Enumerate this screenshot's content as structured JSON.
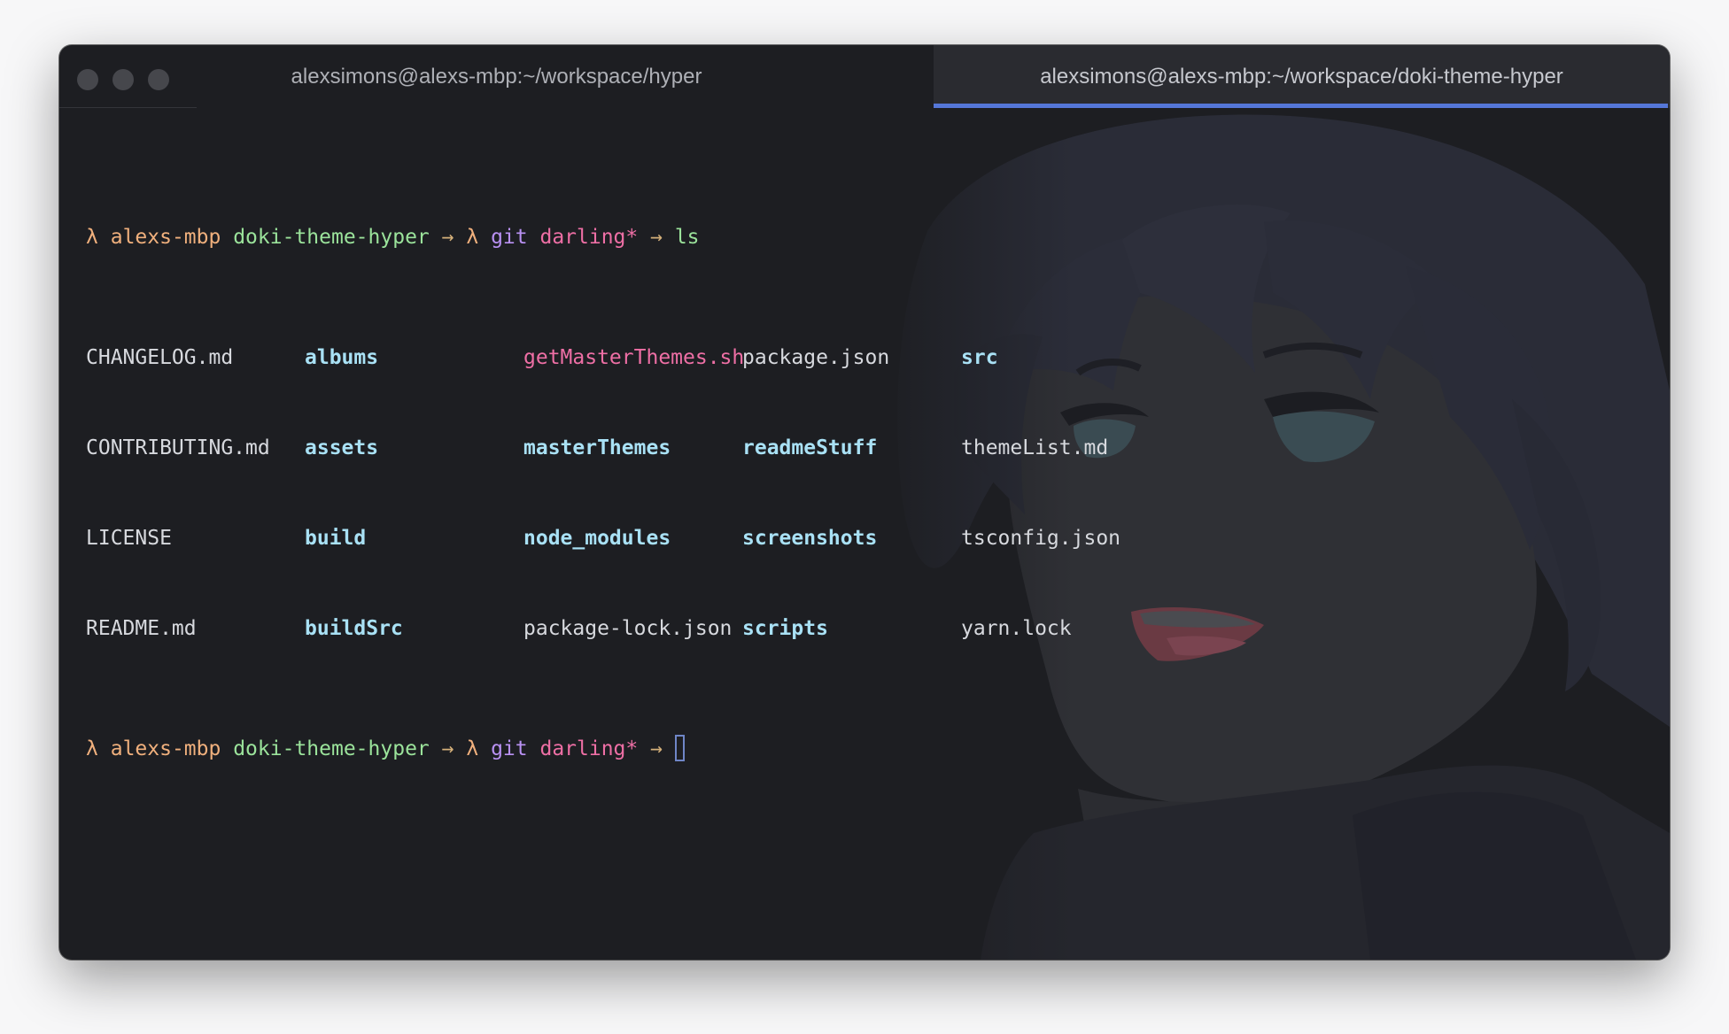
{
  "window": {
    "tabs": [
      {
        "label": "alexsimons@alexs-mbp:~/workspace/hyper",
        "active": false
      },
      {
        "label": "alexsimons@alexs-mbp:~/workspace/doki-theme-hyper",
        "active": true
      }
    ]
  },
  "colors": {
    "terminal_bg": "#1d1e22",
    "orange": "#f0b07d",
    "green": "#9be39b",
    "purple": "#b991f3",
    "pink": "#ee6fa5",
    "cyan": "#a9e1f5",
    "text": "#d7d9de",
    "arrow": "#d4b07a",
    "active_tab_indicator": "#5577d8"
  },
  "prompt": {
    "lambda": "λ",
    "host": "alexs-mbp",
    "dir": "doki-theme-hyper",
    "arrow": "→",
    "git_label": "git",
    "branch": "darling*"
  },
  "commands": [
    {
      "text": "ls"
    },
    {
      "text": ""
    }
  ],
  "ls_output": {
    "columns": [
      [
        {
          "name": "CHANGELOG.md",
          "type": "file"
        },
        {
          "name": "CONTRIBUTING.md",
          "type": "file"
        },
        {
          "name": "LICENSE",
          "type": "file"
        },
        {
          "name": "README.md",
          "type": "file"
        }
      ],
      [
        {
          "name": "albums",
          "type": "dir"
        },
        {
          "name": "assets",
          "type": "dir"
        },
        {
          "name": "build",
          "type": "dir"
        },
        {
          "name": "buildSrc",
          "type": "dir"
        }
      ],
      [
        {
          "name": "getMasterThemes.sh",
          "type": "exec"
        },
        {
          "name": "masterThemes",
          "type": "dir"
        },
        {
          "name": "node_modules",
          "type": "dir"
        },
        {
          "name": "package-lock.json",
          "type": "file"
        }
      ],
      [
        {
          "name": "package.json",
          "type": "file"
        },
        {
          "name": "readmeStuff",
          "type": "dir"
        },
        {
          "name": "screenshots",
          "type": "dir"
        },
        {
          "name": "scripts",
          "type": "dir"
        }
      ],
      [
        {
          "name": "src",
          "type": "dir"
        },
        {
          "name": "themeList.md",
          "type": "file"
        },
        {
          "name": "tsconfig.json",
          "type": "file"
        },
        {
          "name": "yarn.lock",
          "type": "file"
        }
      ]
    ]
  }
}
